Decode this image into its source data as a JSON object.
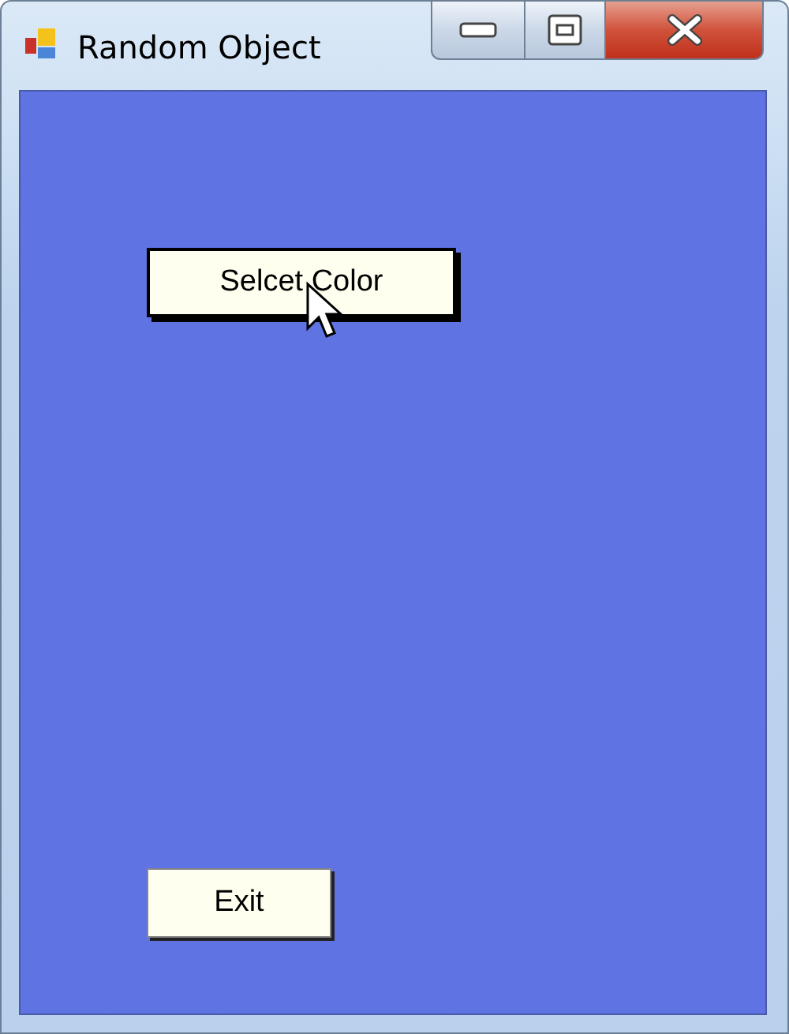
{
  "window": {
    "title": "Random Object"
  },
  "buttons": [
    {
      "label": "Selcet Color",
      "focused": true
    },
    {
      "label": "Exit",
      "focused": false
    }
  ]
}
